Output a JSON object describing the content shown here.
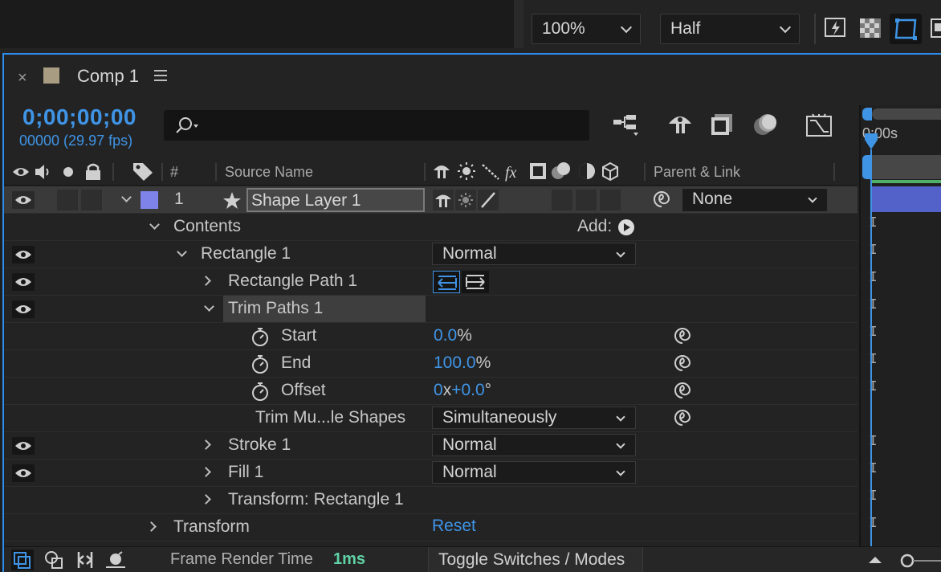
{
  "viewer_toolbar": {
    "zoom_value": "100%",
    "resolution_value": "Half",
    "icons": [
      "fast-previews-icon",
      "transparency-grid-icon",
      "mask-path-visibility-icon",
      "region-of-interest-icon"
    ]
  },
  "panel": {
    "close_glyph": "×",
    "comp_name": "Comp 1",
    "swatch_color": "#a89c83"
  },
  "time": {
    "timecode": "0;00;00;00",
    "frames_fps": "00000 (29.97 fps)"
  },
  "search": {
    "placeholder": ""
  },
  "columns": {
    "number": "#",
    "source_name": "Source Name",
    "parent_link": "Parent & Link"
  },
  "layer": {
    "index": "1",
    "name": "Shape Layer 1",
    "label_color": "#7d83e8",
    "parent_value": "None"
  },
  "properties": {
    "contents": "Contents",
    "add_label": "Add:",
    "rectangle": "Rectangle 1",
    "rectangle_mode": "Normal",
    "rectangle_path": "Rectangle Path 1",
    "trim_paths": "Trim Paths 1",
    "start_label": "Start",
    "start_value": "0.0",
    "start_unit": "%",
    "end_label": "End",
    "end_value": "100.0",
    "end_unit": "%",
    "offset_label": "Offset",
    "offset_rev": "0",
    "offset_x": "x",
    "offset_deg": "+0.0",
    "offset_unit": "°",
    "trim_multiple_label": "Trim Mu...le Shapes",
    "trim_multiple_value": "Simultaneously",
    "stroke": "Stroke 1",
    "stroke_mode": "Normal",
    "fill": "Fill 1",
    "fill_mode": "Normal",
    "transform_rect": "Transform: Rectangle 1",
    "transform": "Transform",
    "reset": "Reset"
  },
  "timeline": {
    "time_label": "0:00s"
  },
  "footer": {
    "frame_render_label": "Frame Render Time",
    "frame_render_value": "1ms",
    "toggle_label": "Toggle Switches / Modes",
    "accent_green": "#5fd3a6"
  }
}
